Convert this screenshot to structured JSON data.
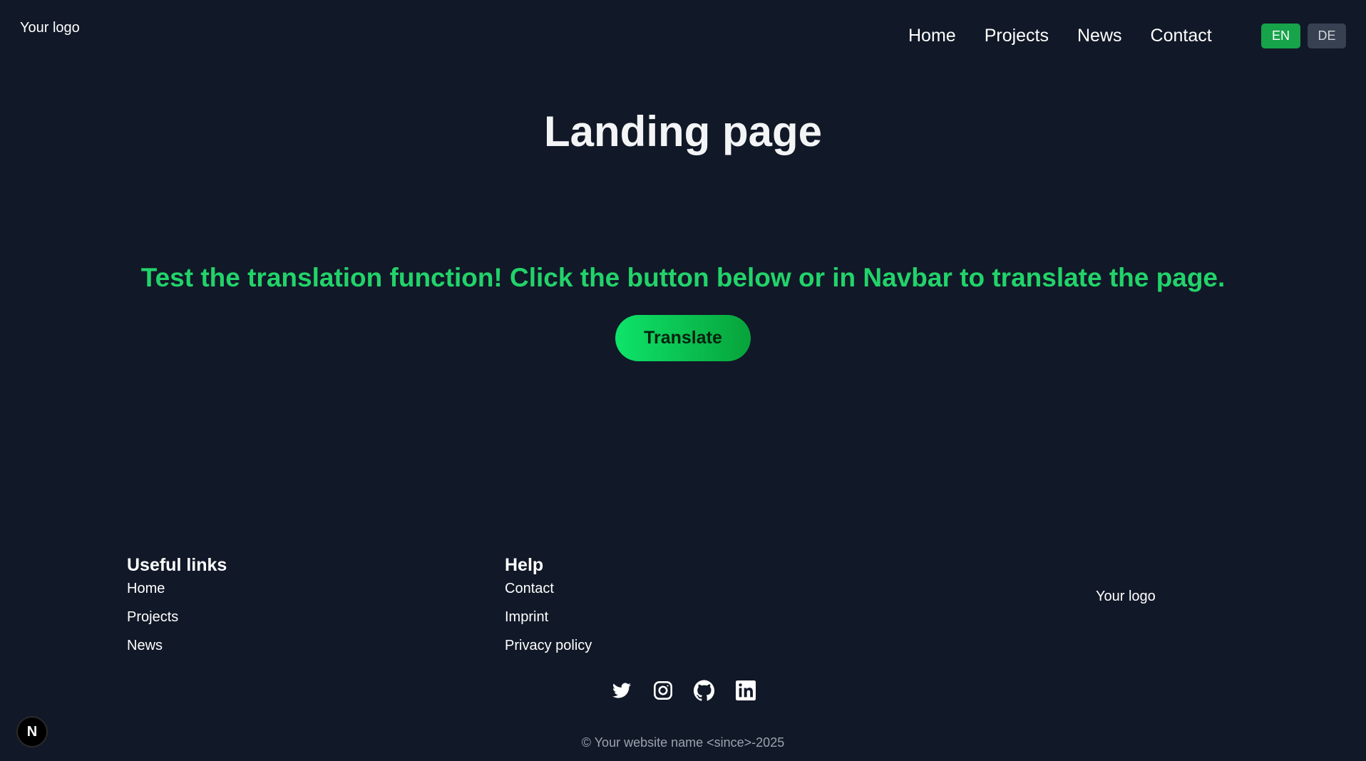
{
  "header": {
    "logo": "Your logo",
    "nav": [
      "Home",
      "Projects",
      "News",
      "Contact"
    ],
    "languages": {
      "en": "EN",
      "de": "DE",
      "active": "EN"
    }
  },
  "hero": {
    "title": "Landing page",
    "subtitle": "Test the translation function! Click the button below or in Navbar to translate the page.",
    "button": "Translate"
  },
  "footer": {
    "useful_links": {
      "heading": "Useful links",
      "links": [
        "Home",
        "Projects",
        "News"
      ]
    },
    "help": {
      "heading": "Help",
      "links": [
        "Contact",
        "Imprint",
        "Privacy policy"
      ]
    },
    "logo": "Your logo",
    "socials": [
      "twitter-icon",
      "instagram-icon",
      "github-icon",
      "linkedin-icon"
    ],
    "copyright": "© Your website name <since>-2025"
  },
  "dev_badge": "N",
  "colors": {
    "background": "#111827",
    "accent_green": "#22d36a",
    "lang_active": "#16a34a",
    "lang_inactive": "#374151"
  }
}
